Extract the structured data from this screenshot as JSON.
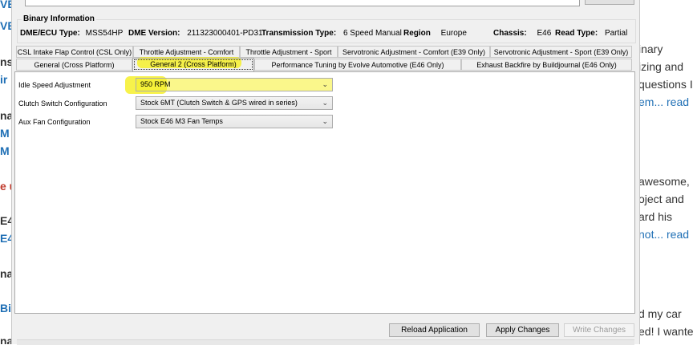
{
  "background_left": [
    {
      "text": "VE",
      "color": "#1f6fb5"
    },
    {
      "text": "VE",
      "color": "#1f6fb5"
    },
    {
      "text": "nsi",
      "color": "#333333"
    },
    {
      "text": "ir",
      "color": "#1f6fb5"
    },
    {
      "text": "na",
      "color": "#333333"
    },
    {
      "text": "M",
      "color": "#1f6fb5"
    },
    {
      "text": "M",
      "color": "#1f6fb5"
    },
    {
      "text": "e u",
      "color": "#c0392b"
    },
    {
      "text": "E4",
      "color": "#333333"
    },
    {
      "text": "E4",
      "color": "#1f6fb5"
    },
    {
      "text": "na",
      "color": "#333333"
    },
    {
      "text": "Bir",
      "color": "#1f6fb5"
    },
    {
      "text": "na",
      "color": "#333333"
    }
  ],
  "background_right": [
    {
      "text": "inary",
      "link": false
    },
    {
      "text": "izing and",
      "link": false
    },
    {
      "text": "questions I",
      "link": false
    },
    {
      "text": "em... read",
      "link": true
    },
    {
      "text": "awesome,",
      "link": false
    },
    {
      "text": "oject and",
      "link": false
    },
    {
      "text": "ard his",
      "link": false
    },
    {
      "text": "not... read",
      "link": true
    },
    {
      "text": "d my car",
      "link": false
    },
    {
      "text": "ed! I wante",
      "link": false
    }
  ],
  "binary_info": {
    "title": "Binary Information",
    "dme_type_label": "DME/ECU Type:",
    "dme_type_value": "MSS54HP",
    "dme_version_label": "DME Version:",
    "dme_version_value": "211323000401-PD31",
    "transmission_label": "Transmission Type:",
    "transmission_value": "6 Speed Manual",
    "region_label": "Region",
    "region_value": "Europe",
    "chassis_label": "Chassis:",
    "chassis_value": "E46",
    "read_type_label": "Read Type:",
    "read_type_value": "Partial"
  },
  "tabs_row1": [
    "CSL Intake Flap Control (CSL Only)",
    "Throttle Adjustment - Comfort",
    "Throttle Adjustment - Sport",
    "Servotronic Adjustment - Comfort (E39 Only)",
    "Servotronic Adjustment - Sport (E39 Only)"
  ],
  "tabs_row2": [
    "General (Cross Platform)",
    "General 2 (Cross Platform)",
    "Performance Tuning by Evolve Automotive (E46 Only)",
    "Exhaust Backfire by Buildjournal (E46 Only)"
  ],
  "active_tab": "General 2 (Cross Platform)",
  "settings": [
    {
      "label": "Idle Speed Adjustment",
      "value": "950 RPM"
    },
    {
      "label": "Clutch Switch Configuration",
      "value": "Stock 6MT (Clutch Switch & GPS wired in series)"
    },
    {
      "label": "Aux Fan Configuration",
      "value": "Stock E46 M3 Fan Temps"
    }
  ],
  "buttons": {
    "reload": "Reload Application",
    "apply": "Apply Changes",
    "write": "Write Changes"
  },
  "colors": {
    "highlight": "#f6f02c",
    "link": "#1f6fb5",
    "window_bg": "#f0f0f0"
  },
  "icons": {
    "dropdown": "chevron-down-icon"
  }
}
